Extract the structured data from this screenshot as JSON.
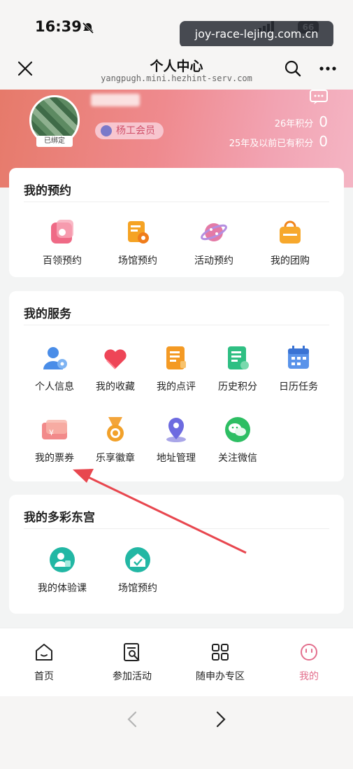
{
  "status_bar": {
    "time": "16:39",
    "battery": "66",
    "watermark": "joy-race-lejing.com.cn"
  },
  "nav": {
    "title": "个人中心",
    "subtitle": "yangpugh.mini.hezhint-serv.com"
  },
  "profile": {
    "bound_tag": "已绑定",
    "member_badge": "杨工会员",
    "points_26_label": "26年积分",
    "points_26_value": "0",
    "points_25_label": "25年及以前已有积分",
    "points_25_value": "0"
  },
  "reservations": {
    "title": "我的预约",
    "items": [
      {
        "label": "百领预约",
        "icon": "bailing-reserve-icon"
      },
      {
        "label": "场馆预约",
        "icon": "venue-reserve-icon"
      },
      {
        "label": "活动预约",
        "icon": "activity-reserve-icon"
      },
      {
        "label": "我的团购",
        "icon": "group-buy-icon"
      }
    ]
  },
  "services": {
    "title": "我的服务",
    "items": [
      {
        "label": "个人信息",
        "icon": "personal-info-icon"
      },
      {
        "label": "我的收藏",
        "icon": "favorites-heart-icon"
      },
      {
        "label": "我的点评",
        "icon": "review-icon"
      },
      {
        "label": "历史积分",
        "icon": "points-history-icon"
      },
      {
        "label": "日历任务",
        "icon": "calendar-icon"
      },
      {
        "label": "我的票券",
        "icon": "ticket-icon"
      },
      {
        "label": "乐享徽章",
        "icon": "badge-medal-icon"
      },
      {
        "label": "地址管理",
        "icon": "location-pin-icon"
      },
      {
        "label": "关注微信",
        "icon": "wechat-icon"
      }
    ]
  },
  "dongong": {
    "title": "我的多彩东宫",
    "items": [
      {
        "label": "我的体验课",
        "icon": "trial-class-icon"
      },
      {
        "label": "场馆预约",
        "icon": "venue-home-icon"
      }
    ]
  },
  "tabbar": {
    "items": [
      {
        "label": "首页",
        "icon": "home-icon"
      },
      {
        "label": "参加活动",
        "icon": "join-activity-icon"
      },
      {
        "label": "随申办专区",
        "icon": "grid-icon"
      },
      {
        "label": "我的",
        "icon": "smile-icon",
        "active": true
      }
    ]
  },
  "colors": {
    "accent": "#e36f8d",
    "banner_start": "#e67a6a",
    "banner_end": "#f4b5c4",
    "annotation_arrow": "#e8474f"
  }
}
